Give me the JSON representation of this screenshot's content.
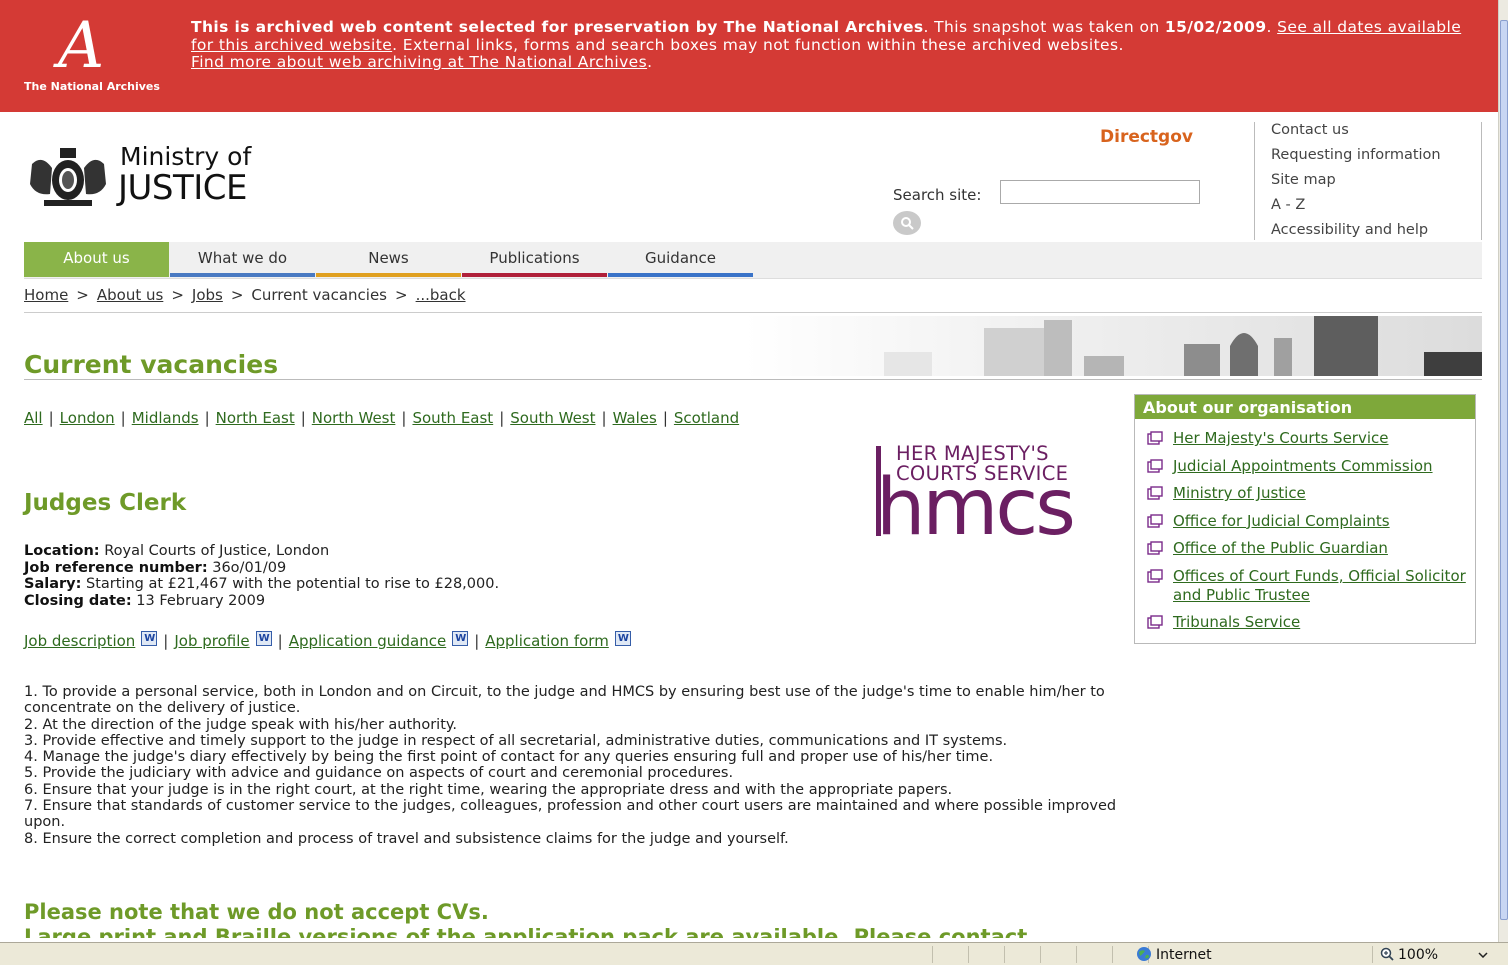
{
  "banner": {
    "text_bold": "This is archived web content selected for preservation by The National Archives",
    "text_mid": ". This snapshot was taken on ",
    "date": "15/02/2009",
    "link_dates": "See all dates available for this archived website",
    "text_ext": ". External links, forms and search boxes may not function within these archived websites.",
    "link_more": "Find more about web archiving at The National Archives",
    "end": ".",
    "logo_caption": "The National Archives"
  },
  "header": {
    "logo_line1": "Ministry of",
    "logo_line2": "JUSTICE",
    "directgov": "Directgov",
    "search_label": "Search site:",
    "search_value": "",
    "util_links": [
      "Contact us",
      "Requesting information",
      "Site map",
      "A - Z",
      "Accessibility and help"
    ]
  },
  "nav": {
    "tabs": [
      "About us",
      "What we do",
      "News",
      "Publications",
      "Guidance"
    ],
    "underline_colors": [
      "#8ab449",
      "#4a7ac2",
      "#e0a020",
      "#b0203a",
      "#3a73c8"
    ]
  },
  "breadcrumb": {
    "links": [
      "Home",
      "About us",
      "Jobs"
    ],
    "current": "Current vacancies",
    "back": "...back",
    "sep": ">"
  },
  "page_title": "Current vacancies",
  "regions": [
    "All",
    "London",
    "Midlands",
    "North East",
    "North West",
    "South East",
    "South West",
    "Wales",
    "Scotland"
  ],
  "hmcs": {
    "line1": "HER MAJESTY'S",
    "line2": "COURTS SERVICE",
    "mark": "hmcs"
  },
  "job": {
    "title": "Judges Clerk",
    "location_label": "Location:",
    "location": "Royal Courts of Justice, London",
    "ref_label": "Job reference number:",
    "ref": "36o/01/09",
    "salary_label": "Salary:",
    "salary": "Starting at £21,467 with the potential to rise to £28,000.",
    "closing_label": "Closing date:",
    "closing": "13 February 2009",
    "docs": [
      "Job description",
      "Job profile",
      "Application guidance",
      "Application form"
    ],
    "duties": [
      "1. To provide a personal service, both in London and on Circuit, to the judge and HMCS by ensuring best use of the judge's time to enable him/her to concentrate on the delivery of justice.",
      "2. At the direction of the judge speak with his/her authority.",
      "3. Provide effective and timely support to the judge in respect of all secretarial, administrative duties, communications and IT systems.",
      "4. Manage the judge's diary effectively by being the first point of contact for any queries ensuring full and proper use of his/her time.",
      "5. Provide the judiciary with advice and guidance on aspects of court and ceremonial procedures.",
      "6. Ensure that your judge is in the right court, at the right time, wearing the appropriate dress and with the appropriate papers.",
      "7. Ensure that standards of customer service to the judges, colleagues, profession and other court users are maintained and where possible improved upon.",
      "8. Ensure the correct completion and process of travel and subsistence claims for the judge and yourself."
    ],
    "note": "Please note that we do not accept CVs.",
    "note2": "Large print and Braille versions of the application pack are available. Please contact"
  },
  "sidebar": {
    "heading": "About our organisation",
    "links": [
      "Her Majesty's Courts Service",
      "Judicial Appointments Commission",
      "Ministry of Justice",
      "Office for Judicial Complaints",
      "Office of the Public Guardian",
      "Offices of Court Funds, Official Solicitor and Public Trustee",
      "Tribunals Service"
    ]
  },
  "statusbar": {
    "zone": "Internet",
    "zoom": "100%"
  },
  "colors": {
    "banner": "#d43a35",
    "green_heading": "#6e9a28",
    "link_green": "#2e6a1e",
    "hmcs_purple": "#6b1f62",
    "directgov": "#d8631d"
  }
}
